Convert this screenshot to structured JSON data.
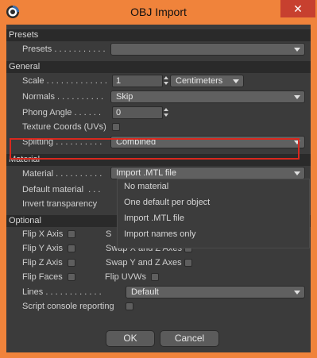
{
  "window": {
    "title": "OBJ Import",
    "close_symbol": "✕",
    "app_icon": "cinema4d-icon"
  },
  "sections": {
    "presets": "Presets",
    "general": "General",
    "material": "Material",
    "optional": "Optional"
  },
  "presets": {
    "label": "Presets . . . . . . . . . . .",
    "value": ""
  },
  "general": {
    "scale_label": "Scale . . . . . . . . . . . . .",
    "scale_value": "1",
    "scale_unit": "Centimeters",
    "normals_label": "Normals . . . . . . . . . .",
    "normals_value": "Skip",
    "phong_label": "Phong Angle . . . . . .",
    "phong_value": "0",
    "texcoords_label": "Texture Coords (UVs)",
    "texcoords_checked": false,
    "splitting_label": "Splitting . . . . . . . . . .",
    "splitting_value": "Combined"
  },
  "material": {
    "material_label": "Material . . . . . . . . . .",
    "material_value": "Import .MTL file",
    "default_material_label": "Default material  . . .",
    "invert_transparency_label": "Invert transparency",
    "options": [
      "No material",
      "One default per object",
      "Import .MTL file",
      "Import names only"
    ]
  },
  "optional": {
    "flip_x": "Flip X Axis",
    "flip_y": "Flip Y Axis",
    "flip_z": "Flip Z Axis",
    "flip_faces": "Flip Faces",
    "swap_xz_partial": "S",
    "swap_xz": "Swap X and Z Axes",
    "swap_yz": "Swap Y and Z Axes",
    "flip_uvws": "Flip UVWs",
    "lines_label": "Lines . . . . . . . . . . . .",
    "lines_value": "Default",
    "script_console": "Script console reporting"
  },
  "buttons": {
    "ok": "OK",
    "cancel": "Cancel"
  },
  "colors": {
    "title_bar": "#f0833b",
    "panel": "#3b3b3b",
    "highlight": "#d9281e",
    "close": "#c7402f"
  }
}
